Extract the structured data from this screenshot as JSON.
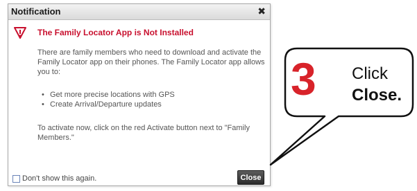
{
  "dialog": {
    "title": "Notification",
    "close_glyph": "✖",
    "warning_icon": "warning-triangle-icon",
    "heading": "The Family Locator App is Not Installed",
    "paragraph1": "There are family members who need to download and activate the Family Locator app on their phones. The Family Locator app allows you to:",
    "bullets": [
      "Get more precise locations with GPS",
      "Create Arrival/Departure updates"
    ],
    "paragraph2": "To activate now, click on the red Activate button next to \"Family Members.\"",
    "checkbox_label": "Don't show this again.",
    "close_button_label": "Close"
  },
  "callout": {
    "step_number": "3",
    "step_text_line1": "Click",
    "step_text_line2": "Close."
  },
  "colors": {
    "heading_red": "#c8102e",
    "step_number_red": "#d8232a",
    "close_button_bg": "#3a3a3a",
    "body_text": "#555555"
  }
}
